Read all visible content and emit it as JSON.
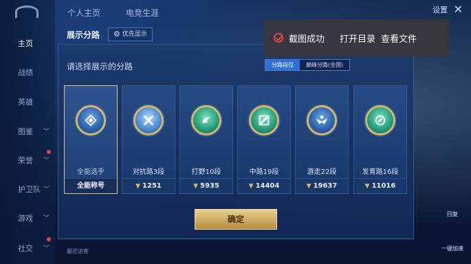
{
  "header": {
    "tabs": [
      "个人主页",
      "电竞生涯"
    ],
    "settings_label": "设置",
    "close_label": "✕"
  },
  "sidebar": {
    "items": [
      {
        "label": "主页",
        "active": true,
        "chevron": false
      },
      {
        "label": "战绩",
        "active": false,
        "chevron": false
      },
      {
        "label": "英雄",
        "active": false,
        "chevron": false
      },
      {
        "label": "图鉴",
        "active": false,
        "chevron": true
      },
      {
        "label": "荣誉",
        "active": false,
        "chevron": true
      },
      {
        "label": "护卫队",
        "active": false,
        "chevron": true
      },
      {
        "label": "游戏",
        "active": false,
        "chevron": true
      },
      {
        "label": "社交",
        "active": false,
        "chevron": true
      }
    ]
  },
  "dialog": {
    "title": "展示分路",
    "priority_button": "优先显示",
    "prompt": "请选择展示的分路",
    "toggle": {
      "active": "分路段位",
      "inactive": "巅峰分路(全国)"
    },
    "confirm": "确定",
    "cards": [
      {
        "label": "全能选手",
        "value": "全能称号",
        "selected": true,
        "icon": "all-round-emblem-icon"
      },
      {
        "label": "对抗路3段",
        "value": "1251",
        "selected": false,
        "icon": "clash-lane-emblem-icon"
      },
      {
        "label": "打野10段",
        "value": "5935",
        "selected": false,
        "icon": "jungle-emblem-icon"
      },
      {
        "label": "中路19段",
        "value": "14404",
        "selected": false,
        "icon": "mid-lane-emblem-icon"
      },
      {
        "label": "游走22段",
        "value": "19637",
        "selected": false,
        "icon": "roam-emblem-icon"
      },
      {
        "label": "发育路16段",
        "value": "11016",
        "selected": false,
        "icon": "farm-lane-emblem-icon"
      }
    ]
  },
  "toast": {
    "message": "截图成功",
    "open_dir": "打开目录",
    "view_file": "查看文件"
  },
  "bottom_hint": "最近访客",
  "right_labels": [
    "回复",
    "一键加速"
  ],
  "colors": {
    "accent_gold": "#d8b868",
    "toggle_active": "#2e6fd8",
    "toast_icon": "#e04848"
  }
}
